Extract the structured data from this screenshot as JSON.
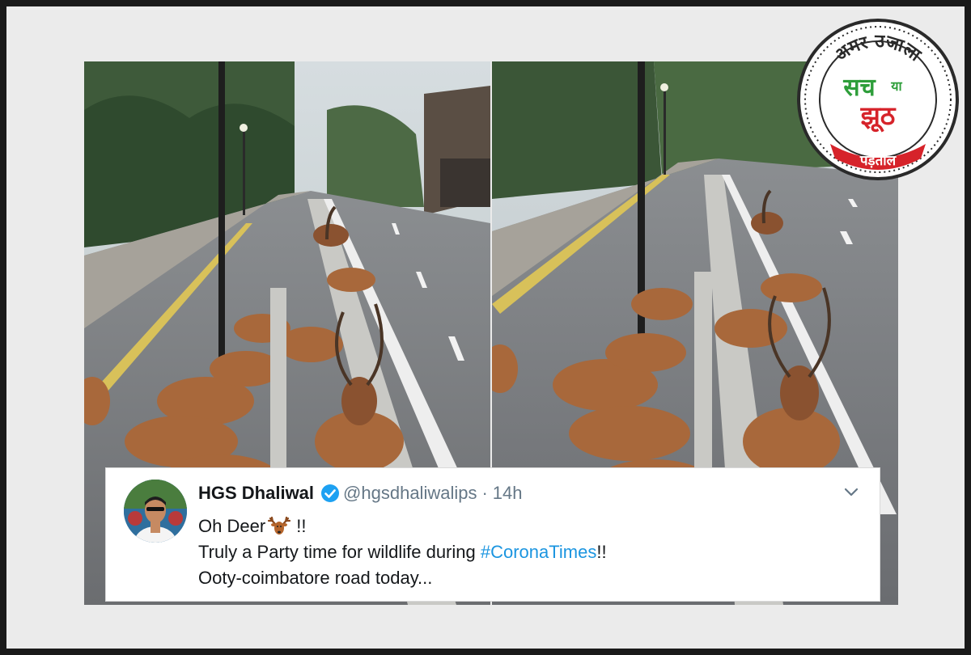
{
  "stamp": {
    "brand": "अमर उजाला",
    "top_word": "सच",
    "middle_word": "या",
    "bottom_word": "झूठ",
    "footer": "पड़ताल",
    "colors": {
      "ring": "#2a2a2a",
      "green": "#2e9e3a",
      "red": "#d6232a"
    }
  },
  "tweet": {
    "author_name": "HGS Dhaliwal",
    "verified_icon": "verified-badge-icon",
    "handle": "@hgsdhaliwalips",
    "separator": "·",
    "time": "14h",
    "menu_icon": "chevron-down-icon",
    "line1_prefix": "Oh Deer",
    "emoji": "deer-emoji",
    "line1_suffix": " !!",
    "line2_prefix": "Truly a Party time for wildlife during ",
    "hashtag": "#CoronaTimes",
    "line2_suffix": "!!",
    "line3": "Ooty-coimbatore road today...",
    "colors": {
      "text": "#14171a",
      "muted": "#657786",
      "link": "#1b95e0",
      "verified": "#1da1f2"
    }
  },
  "photos": [
    "deer-road-photo-left",
    "deer-road-photo-right"
  ]
}
